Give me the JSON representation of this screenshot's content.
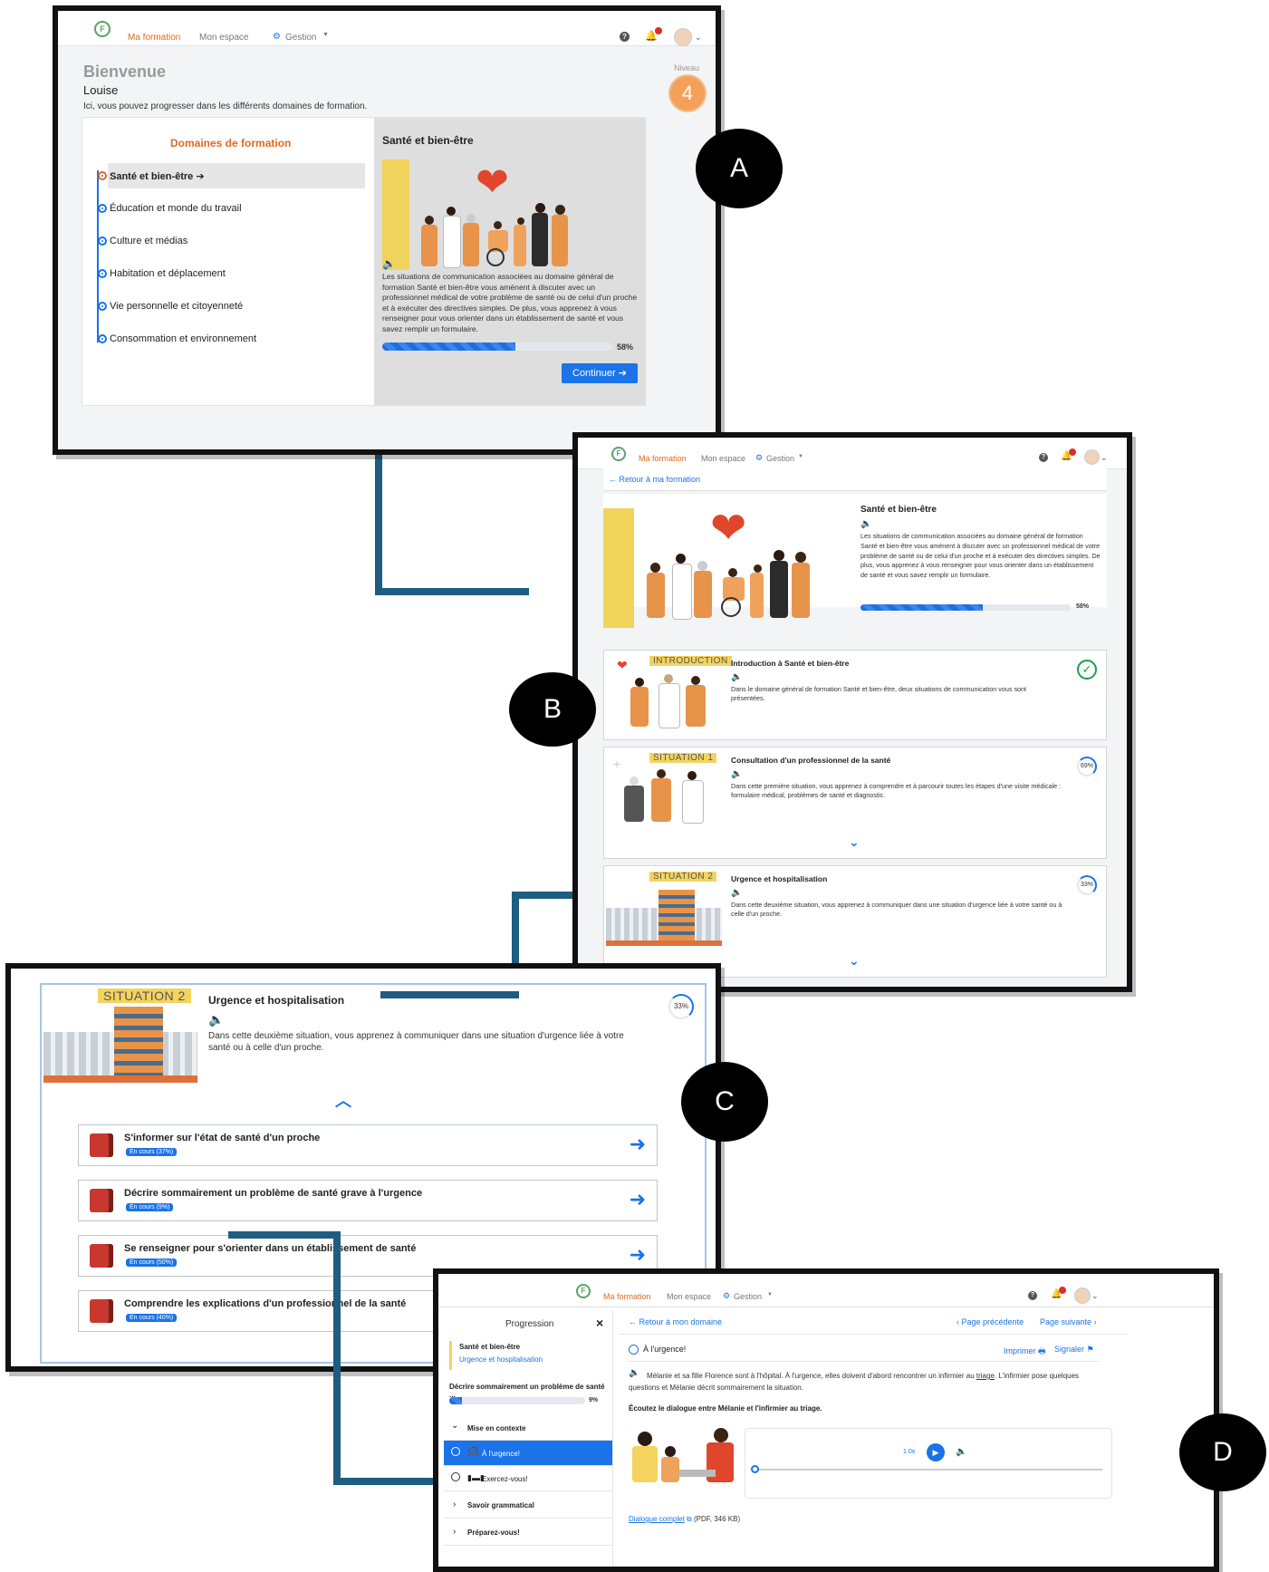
{
  "nav": {
    "logo": "F",
    "ma_formation": "Ma formation",
    "mon_espace": "Mon espace",
    "gestion": "Gestion"
  },
  "callouts": {
    "a": "A",
    "b": "B",
    "c": "C",
    "d": "D"
  },
  "panelA": {
    "welcome": "Bienvenue",
    "user": "Louise",
    "intro": "Ici, vous pouvez progresser dans les différents domaines de formation.",
    "niveau_label": "Niveau",
    "niveau_value": "4",
    "domains_title": "Domaines de formation",
    "domains": [
      "Santé et bien-être",
      "Éducation et monde du travail",
      "Culture et médias",
      "Habitation et déplacement",
      "Vie personnelle et citoyenneté",
      "Consommation et environnement"
    ],
    "detail_title": "Santé et bien-être",
    "detail_text": "Les situations de communication associées au domaine général de formation Santé et bien-être vous amènent à discuter avec un professionnel médical de votre problème de santé ou de celui d'un proche et à exécuter des directives simples. De plus, vous apprenez à vous renseigner pour vous orienter dans un établissement de santé et vous savez remplir un formulaire.",
    "progress": 0.58,
    "progress_label": "58%",
    "continue": "Continuer"
  },
  "panelB": {
    "back": "Retour à ma formation",
    "title": "Santé et bien-être",
    "text": "Les situations de communication associées au domaine général de formation Santé et bien-être vous amènent à discuter avec un professionnel médical de votre problème de santé ou de celui d'un proche et à exécuter des directives simples. De plus, vous apprenez à vous renseigner pour vous orienter dans un établissement de santé et vous savez remplir un formulaire.",
    "progress": 0.58,
    "progress_label": "58%",
    "cards": [
      {
        "tag": "INTRODUCTION",
        "title": "Introduction à Santé et bien-être",
        "text": "Dans le domaine général de formation Santé et bien-être, deux situations de communication vous sont présentées."
      },
      {
        "tag": "SITUATION 1",
        "title": "Consultation d'un professionnel de la santé",
        "text": "Dans cette première situation, vous apprenez à comprendre et à parcourir toutes les étapes d'une visite médicale : formulaire médical, problèmes de santé et diagnostic.",
        "ring": "69%"
      },
      {
        "tag": "SITUATION 2",
        "title": "Urgence et hospitalisation",
        "text": "Dans cette deuxième situation, vous apprenez à communiquer dans une situation d'urgence liée à votre santé ou à celle d'un proche.",
        "ring": "33%"
      }
    ]
  },
  "panelC": {
    "tag": "SITUATION 2",
    "title": "Urgence et hospitalisation",
    "text": "Dans cette deuxième situation, vous apprenez à communiquer dans une situation d'urgence liée à votre santé ou à celle d'un proche.",
    "ring": "33%",
    "lessons": [
      {
        "title": "S'informer sur l'état de santé d'un proche",
        "badge": "En cours (37%)"
      },
      {
        "title": "Décrire sommairement un problème de santé grave à l'urgence",
        "badge": "En cours (9%)"
      },
      {
        "title": "Se renseigner pour s'orienter dans un établissement de santé",
        "badge": "En cours (50%)"
      },
      {
        "title": "Comprendre les explications d'un professionnel de la santé",
        "badge": "En cours (40%)"
      }
    ]
  },
  "panelD": {
    "sidebar_title": "Progression",
    "close": "×",
    "domain": "Santé et bien-être",
    "situation": "Urgence et hospitalisation",
    "lesson": "Décrire sommairement un problème de santé ...",
    "lesson_progress": 0.09,
    "lesson_pct": "9%",
    "sections": [
      {
        "label": "Mise en contexte",
        "open": true
      },
      {
        "label": "Savoir grammatical",
        "open": false
      },
      {
        "label": "Préparez-vous!",
        "open": false
      }
    ],
    "activities": [
      {
        "label": "À l'urgence!",
        "active": true
      },
      {
        "label": "Exercez-vous!",
        "active": false
      }
    ],
    "back": "Retour à mon domaine",
    "prev": "Page précédente",
    "next": "Page suivante",
    "page_title": "À l'urgence!",
    "print": "Imprimer",
    "report": "Signaler",
    "para_before": "Mélanie et sa fille Florence sont à l'hôpital. À l'urgence, elles doivent d'abord rencontrer un infirmier au ",
    "para_link": "triage",
    "para_after": ". L'infirmier pose quelques questions et Mélanie décrit sommairement la situation.",
    "instruction": "Écoutez le dialogue entre Mélanie et l'infirmier au triage.",
    "speed": "1.0x",
    "dialogue_link": "Dialogue complet",
    "dialogue_meta": "(PDF, 346 KB)"
  },
  "colors": {
    "accent": "#e06a1f",
    "primary": "#1a73e8",
    "connector": "#1e5d80",
    "yellow": "#f4d35e"
  }
}
